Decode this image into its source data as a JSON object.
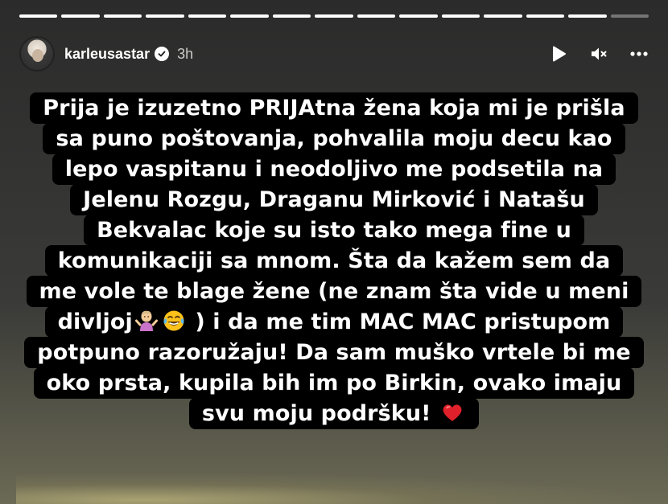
{
  "story": {
    "progress_segments": 15,
    "progress_done": 14
  },
  "header": {
    "username": "karleusastar",
    "verified_icon": "verified-badge-icon",
    "time": "3h",
    "icons": [
      "play-icon",
      "muted-speaker-icon",
      "more-options-icon"
    ]
  },
  "caption": {
    "lines": [
      "Prija je izuzetno PRIJAtna žena koja mi je prišla",
      "sa puno poštovanja, pohvalila moju decu kao",
      "lepo vaspitanu i neodoljivo me podsetila na",
      "Jelenu Rozgu, Draganu Mirković i Natašu",
      "Bekvalac koje su isto tako mega fine u",
      "komunikaciji sa mnom. Šta da kažem sem da",
      "me vole te blage žene (ne znam šta vide u meni"
    ],
    "line8_before": "divljoj",
    "line8_after": " ) i da me tim MAC MAC pristupom",
    "lines_end": [
      "potpuno razoružaju! Da sam muško vrtele bi me",
      "oko prsta, kupila bih im po Birkin, ovako imaju"
    ],
    "last_line": "svu moju podršku! ",
    "emojis": [
      "woman-shrugging-emoji",
      "face-with-tears-of-joy-emoji",
      "red-heart-emoji"
    ]
  },
  "colors": {
    "text": "#ffffff",
    "caption_bg": "#000000",
    "heart": "#e0202a"
  }
}
